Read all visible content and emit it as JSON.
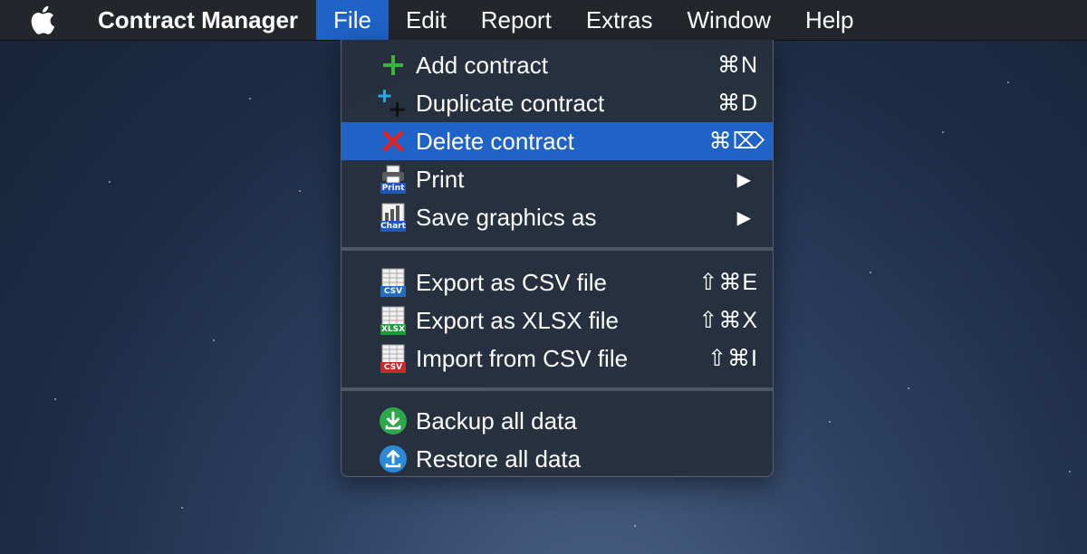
{
  "menubar": {
    "app_name": "Contract Manager",
    "menus": [
      "File",
      "Edit",
      "Report",
      "Extras",
      "Window",
      "Help"
    ],
    "active_menu": "File"
  },
  "file_menu": {
    "groups": [
      [
        {
          "label": "Add contract",
          "shortcut": "⌘N",
          "icon": "plus-icon"
        },
        {
          "label": "Duplicate contract",
          "shortcut": "⌘D",
          "icon": "duplicate-icon"
        },
        {
          "label": "Delete contract",
          "shortcut": "⌘⌦",
          "icon": "delete-icon",
          "highlighted": true
        },
        {
          "label": "Print",
          "submenu": true,
          "icon": "print-icon",
          "icon_tag": "Print"
        },
        {
          "label": "Save graphics as",
          "submenu": true,
          "icon": "chart-icon",
          "icon_tag": "Chart"
        }
      ],
      [
        {
          "label": "Export as CSV file",
          "shortcut": "⇧⌘E",
          "icon": "csv-export-icon",
          "icon_tag": "CSV"
        },
        {
          "label": "Export as XLSX file",
          "shortcut": "⇧⌘X",
          "icon": "xlsx-export-icon",
          "icon_tag": "XLSX"
        },
        {
          "label": "Import from CSV file",
          "shortcut": "⇧⌘I",
          "icon": "csv-import-icon",
          "icon_tag": "CSV"
        }
      ],
      [
        {
          "label": "Backup all data",
          "icon": "backup-icon"
        },
        {
          "label": "Restore all data",
          "icon": "restore-icon"
        }
      ]
    ]
  },
  "colors": {
    "highlight": "#1f63c9",
    "menubar": "#23262b",
    "plus_green": "#3db33d",
    "delete_red": "#e02424",
    "csv_blue": "#1e6fc4",
    "xlsx_green": "#1e9a3a",
    "csv_red": "#c72a2a"
  }
}
